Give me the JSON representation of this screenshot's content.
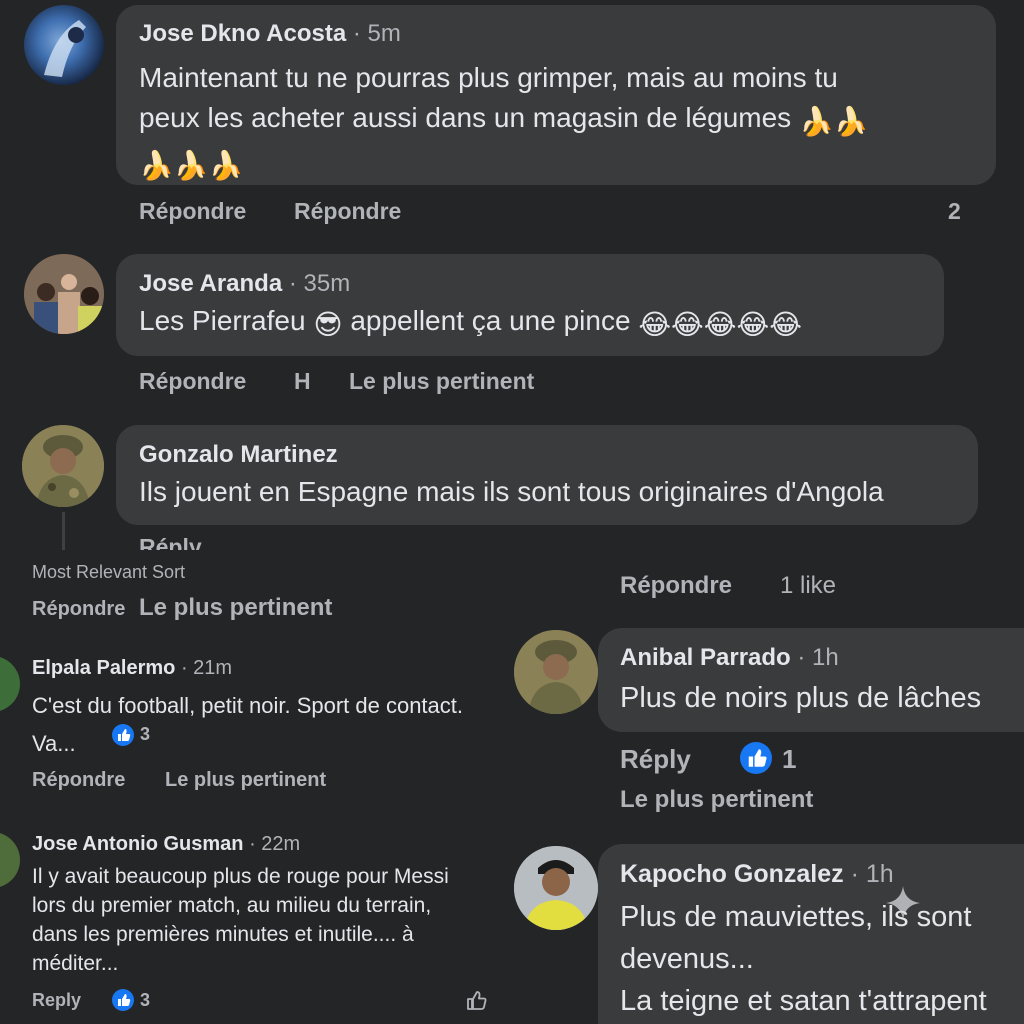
{
  "colors": {
    "bg": "#242526",
    "bubble": "#3a3b3c",
    "text": "#e4e6eb",
    "muted": "#b0b3b8",
    "like_blue": "#1877f2"
  },
  "top": {
    "c1": {
      "name": "Jose Dkno Acosta",
      "time": "· 5m",
      "text_l1": "Maintenant tu ne pourras plus grimper, mais au moins tu",
      "text_l2": "peux les acheter aussi dans un magasin de légumes",
      "reply": "Répondre",
      "reply2": "Répondre",
      "count": "2"
    },
    "c2": {
      "name": "Jose Aranda",
      "time": "· 35m",
      "text_a": "Les Pierrafeu",
      "text_b": "appellent ça une pince",
      "reply": "Répondre",
      "h": "H",
      "relevant": "Le plus pertinent"
    },
    "c3": {
      "name": "Gonzalo Martinez",
      "text": "Ils jouent en Espagne mais ils sont tous originaires d'Angola",
      "reply_cut": "Réply"
    }
  },
  "left": {
    "cut_text": "Most Relevant Sort",
    "reply": "Répondre",
    "relevant": "Le plus pertinent",
    "c1": {
      "name": "Elpala Palermo",
      "time": "· 21m",
      "text_l1": "C'est du football, petit noir. Sport de contact.",
      "text_l2": "Va...",
      "likes": "3",
      "reply": "Répondre",
      "relevant": "Le plus pertinent"
    },
    "c2": {
      "name": "Jose Antonio Gusman",
      "time": "· 22m",
      "text_l1": "Il y avait beaucoup plus de rouge pour Messi",
      "text_l2": "lors du premier match, au milieu du terrain,",
      "text_l3": "dans les premières minutes et inutile.... à",
      "text_l4": "méditer...",
      "reply": "Reply",
      "likes": "3"
    }
  },
  "right": {
    "reply": "Répondre",
    "likes_text": "1 like",
    "c1": {
      "name": "Anibal Parrado",
      "time": "· 1h",
      "text": "Plus de noirs plus de lâches",
      "reply": "Réply",
      "likes": "1",
      "relevant": "Le plus pertinent"
    },
    "c2": {
      "name": "Kapocho Gonzalez",
      "time": "· 1h",
      "text_l1": "Plus de mauviettes, ils sont",
      "text_l2": "devenus...",
      "text_l3": "La teigne et satan t'attrapent"
    }
  }
}
